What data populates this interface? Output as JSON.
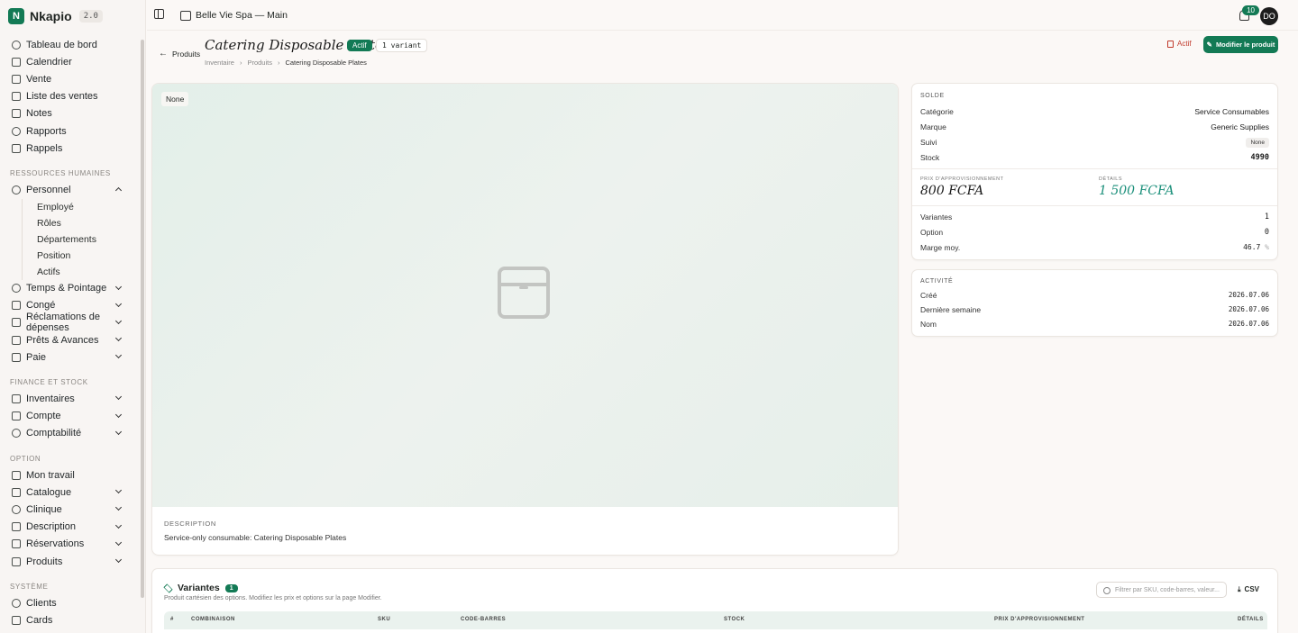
{
  "app": {
    "name": "Nkapio",
    "version": "2.0"
  },
  "topbar": {
    "store": "Belle Vie Spa — Main",
    "notifications": "10",
    "avatar": "DO"
  },
  "nav": {
    "main": [
      {
        "label": "Tableau de bord"
      },
      {
        "label": "Calendrier"
      },
      {
        "label": "Vente"
      },
      {
        "label": "Liste des ventes"
      },
      {
        "label": "Notes"
      },
      {
        "label": "Rapports"
      },
      {
        "label": "Rappels"
      }
    ],
    "hr_section": "RESSOURCES HUMAINES",
    "personnel": "Personnel",
    "personnel_sub": [
      "Employé",
      "Rôles",
      "Départements",
      "Position",
      "Actifs"
    ],
    "hr_items": [
      "Temps & Pointage",
      "Congé",
      "Réclamations de dépenses",
      "Prêts & Avances",
      "Paie"
    ],
    "finance_section": "FINANCE ET STOCK",
    "finance_items": [
      "Inventaires",
      "Compte",
      "Comptabilité"
    ],
    "option_section": "OPTION",
    "option_items": [
      "Mon travail",
      "Catalogue",
      "Clinique",
      "Description",
      "Réservations",
      "Produits"
    ],
    "system_section": "SYSTÈME",
    "system_items": [
      "Clients",
      "Cards"
    ]
  },
  "header": {
    "back": "Produits",
    "title": "Catering Disposable Plates",
    "status": "Actif",
    "variant_pill": "1 variant",
    "breadcrumb": [
      "Inventaire",
      "Produits",
      "Catering Disposable Plates"
    ],
    "btn_actif": "Actif",
    "btn_edit": "Modifier le produit"
  },
  "image": {
    "tag": "None"
  },
  "description": {
    "label": "DESCRIPTION",
    "text": "Service-only consumable: Catering Disposable Plates"
  },
  "solde": {
    "label": "SOLDE",
    "categorie_k": "Catégorie",
    "categorie_v": "Service Consumables",
    "marque_k": "Marque",
    "marque_v": "Generic Supplies",
    "suivi_k": "Suivi",
    "suivi_v": "None",
    "stock_k": "Stock",
    "stock_v": "4990",
    "prix_label": "PRIX D'APPROVISIONNEMENT",
    "prix_v": "800 FCFA",
    "details_label": "DÉTAILS",
    "details_v": "1 500 FCFA",
    "variantes_k": "Variantes",
    "variantes_v": "1",
    "option_k": "Option",
    "option_v": "0",
    "marge_k": "Marge moy.",
    "marge_v": "46.7",
    "marge_unit": "%"
  },
  "activite": {
    "label": "ACTIVITÉ",
    "cree_k": "Créé",
    "cree_v": "2026.07.06",
    "semaine_k": "Dernière semaine",
    "semaine_v": "2026.07.06",
    "nom_k": "Nom",
    "nom_v": "2026.07.06"
  },
  "variants": {
    "title": "Variantes",
    "count": "1",
    "subtitle": "Produit cartésien des options. Modifiez les prix et options sur la page Modifier.",
    "filter_placeholder": "Filtrer par SKU, code-barres, valeur...",
    "csv": "CSV",
    "columns": [
      "#",
      "COMBINAISON",
      "SKU",
      "CODE-BARRES",
      "STOCK",
      "PRIX D'APPROVISIONNEMENT",
      "DÉTAILS"
    ]
  },
  "colors": {
    "accent": "#137a55",
    "danger": "#c0392b",
    "teal_price": "#1a8f7a"
  }
}
